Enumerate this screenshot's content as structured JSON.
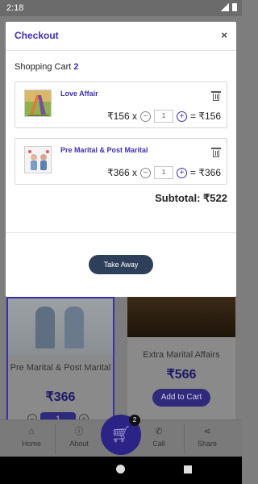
{
  "status": {
    "time": "2:18"
  },
  "modal": {
    "title": "Checkout",
    "close_label": "×",
    "cart_heading": "Shopping Cart",
    "cart_count": "2",
    "items": [
      {
        "name": "Love Affair",
        "unit_price": "₹156 x",
        "qty": "1",
        "total": "= ₹156",
        "minus": "−",
        "plus": "+"
      },
      {
        "name": "Pre Marital & Post Marital",
        "unit_price": "₹366 x",
        "qty": "1",
        "total": "= ₹366",
        "minus": "−",
        "plus": "+"
      }
    ],
    "subtotal": "Subtotal: ₹522",
    "take_away_label": "Take Away"
  },
  "background": {
    "products": [
      {
        "name": "Pre Marital & Post Marital",
        "price": "₹366",
        "qty": "1"
      },
      {
        "name": "Extra Marital Affairs",
        "price": "₹566",
        "add_label": "Add to Cart"
      }
    ]
  },
  "bottom_nav": {
    "items": [
      {
        "label": "Home",
        "icon": "home-icon"
      },
      {
        "label": "About",
        "icon": "info-icon"
      },
      {
        "label": "Call",
        "icon": "phone-icon"
      },
      {
        "label": "Share",
        "icon": "share-icon"
      }
    ],
    "cart_badge": "2"
  },
  "colors": {
    "accent": "#3b31b8",
    "fab": "#2b2385",
    "button": "#2d3f5a"
  }
}
